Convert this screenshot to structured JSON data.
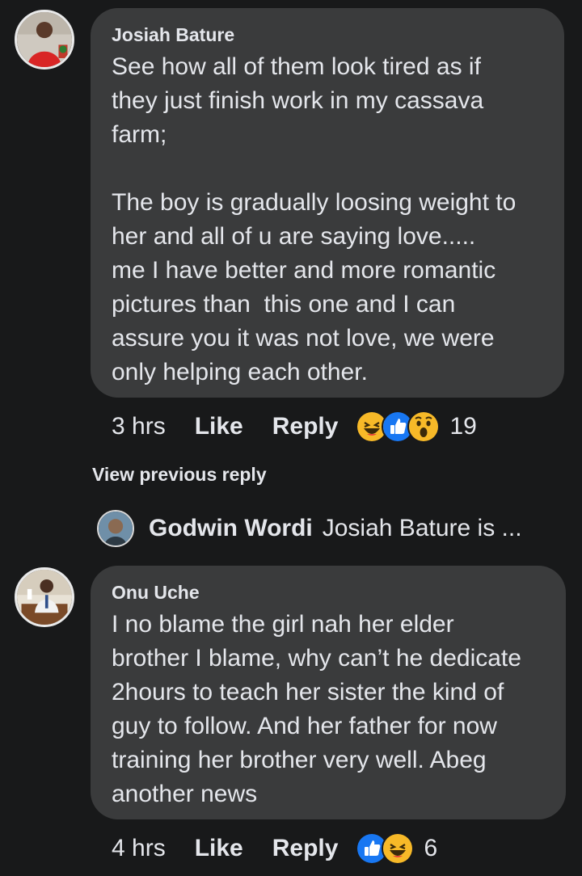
{
  "comments": [
    {
      "author": "Josiah Bature",
      "text": "See how all of them look tired as if\nthey just finish work in my cassava\nfarm;\n\nThe boy is gradually loosing weight to\nher and all of u are saying love.....\nme I have better and more romantic\npictures than  this one and I can\nassure you it was not love, we were\nonly helping each other.",
      "time": "3 hrs",
      "like_label": "Like",
      "reply_label": "Reply",
      "reactions": [
        "haha",
        "like",
        "wow"
      ],
      "reaction_count": "19"
    },
    {
      "author": "Onu Uche",
      "text": "I no blame the girl nah her elder\nbrother I blame, why can’t he dedicate\n2hours to teach her sister the kind of\nguy to follow. And her father for now\ntraining her brother very well. Abeg\nanother news",
      "time": "4 hrs",
      "like_label": "Like",
      "reply_label": "Reply",
      "reactions": [
        "like",
        "haha"
      ],
      "reaction_count": "6"
    }
  ],
  "view_previous": "View previous reply",
  "reply_preview": {
    "name": "Godwin Wordi",
    "snippet": "Josiah Bature  is ..."
  },
  "colors": {
    "background": "#18191a",
    "bubble": "#3a3b3c",
    "text": "#e4e6eb",
    "like_blue": "#1877f2",
    "haha_yellow": "#f7b928"
  }
}
